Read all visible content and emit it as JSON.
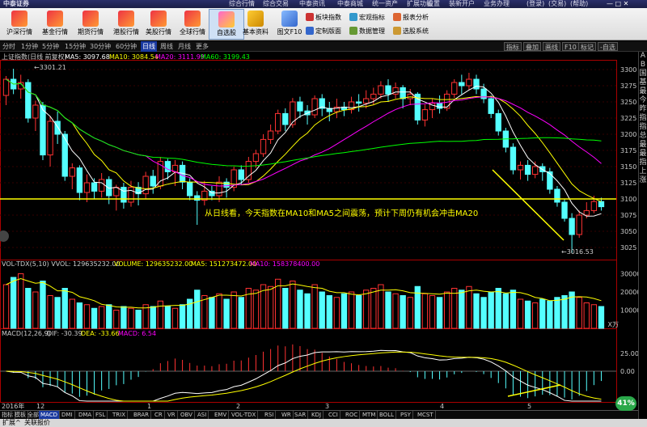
{
  "app": {
    "logo": "中泰证券",
    "menu": [
      "综合行情",
      "综合交易",
      "中泰资讯",
      "中泰商城",
      "统一资产",
      "扩展功能",
      "设置",
      "装新开户",
      "业务办理"
    ],
    "right_menu": [
      "(登录)",
      "(交易)",
      "(帮助)"
    ]
  },
  "toolbar": {
    "buttons": [
      {
        "label": "沪深行情",
        "icon": "chart-icon"
      },
      {
        "label": "基金行情",
        "icon": "chart-icon"
      },
      {
        "label": "期货行情",
        "icon": "chart-icon"
      },
      {
        "label": "港股行情",
        "icon": "chart-icon"
      },
      {
        "label": "美股行情",
        "icon": "chart-icon"
      },
      {
        "label": "全球行情",
        "icon": "chart-icon"
      },
      {
        "label": "自选股",
        "icon": "star-icon"
      },
      {
        "label": "基本资料",
        "icon": "key-icon"
      },
      {
        "label": "图文F10",
        "icon": "document-icon"
      }
    ],
    "small": [
      "板块指数",
      "宏观指标",
      "报表分析",
      "定制版面",
      "数据管理",
      "选股系统"
    ]
  },
  "period": {
    "tabs": [
      "分时",
      "1分钟",
      "5分钟",
      "15分钟",
      "30分钟",
      "60分钟",
      "日线",
      "周线",
      "月线",
      "更多"
    ],
    "active": "日线",
    "right_tools": [
      "指标",
      "叠加",
      "画线",
      "F10",
      "标记",
      "-自选"
    ]
  },
  "chart_data": [
    {
      "type": "candlestick",
      "title": "上证指数(日线 前复权)",
      "legend": [
        {
          "name": "MA5",
          "value": "3097.68",
          "color": "#ffffff"
        },
        {
          "name": "MA10",
          "value": "3084.54",
          "color": "#ffff00"
        },
        {
          "name": "MA20",
          "value": "3111.99",
          "color": "#ff00ff"
        },
        {
          "name": "MA60",
          "value": "3199.43",
          "color": "#00ff00"
        }
      ],
      "y_ticks": [
        3300,
        3275,
        3250,
        3225,
        3200,
        3175,
        3150,
        3125,
        3100,
        3075,
        3050,
        3025
      ],
      "ylim": [
        3010,
        3310
      ],
      "high_label": "3301.21",
      "low_label": "3016.53",
      "support_line": 3100,
      "annotation": "从日线看，今天指数在MA10和MA5之间震荡，预计下周仍有机会冲击MA20",
      "candles": [
        [
          3260,
          3285,
          3245,
          3290
        ],
        [
          3285,
          3270,
          3262,
          3301.21
        ],
        [
          3270,
          3280,
          3255,
          3292
        ],
        [
          3280,
          3225,
          3218,
          3285
        ],
        [
          3225,
          3245,
          3205,
          3252
        ],
        [
          3245,
          3168,
          3160,
          3250
        ],
        [
          3168,
          3220,
          3150,
          3228
        ],
        [
          3220,
          3200,
          3185,
          3235
        ],
        [
          3200,
          3135,
          3128,
          3205
        ],
        [
          3135,
          3148,
          3115,
          3155
        ],
        [
          3148,
          3110,
          3098,
          3152
        ],
        [
          3110,
          3125,
          3095,
          3138
        ],
        [
          3125,
          3112,
          3100,
          3132
        ],
        [
          3112,
          3130,
          3102,
          3140
        ],
        [
          3130,
          3105,
          3092,
          3135
        ],
        [
          3105,
          3118,
          3082,
          3122
        ],
        [
          3118,
          3095,
          3085,
          3125
        ],
        [
          3095,
          3118,
          3088,
          3128
        ],
        [
          3118,
          3108,
          3090,
          3126
        ],
        [
          3108,
          3135,
          3100,
          3142
        ],
        [
          3135,
          3120,
          3108,
          3145
        ],
        [
          3120,
          3158,
          3115,
          3165
        ],
        [
          3158,
          3142,
          3130,
          3162
        ],
        [
          3142,
          3152,
          3120,
          3160
        ],
        [
          3152,
          3126,
          3115,
          3158
        ],
        [
          3126,
          3105,
          3098,
          3132
        ],
        [
          3105,
          3098,
          3060,
          3112
        ],
        [
          3098,
          3112,
          3090,
          3128
        ],
        [
          3112,
          3105,
          3098,
          3120
        ],
        [
          3105,
          3126,
          3095,
          3135
        ],
        [
          3126,
          3118,
          3102,
          3132
        ],
        [
          3118,
          3145,
          3112,
          3150
        ],
        [
          3145,
          3130,
          3122,
          3152
        ],
        [
          3130,
          3158,
          3125,
          3165
        ],
        [
          3158,
          3170,
          3148,
          3176
        ],
        [
          3170,
          3192,
          3165,
          3200
        ],
        [
          3192,
          3205,
          3185,
          3215
        ],
        [
          3205,
          3232,
          3200,
          3238
        ],
        [
          3232,
          3215,
          3205,
          3240
        ],
        [
          3215,
          3250,
          3210,
          3256
        ],
        [
          3250,
          3236,
          3225,
          3258
        ],
        [
          3236,
          3230,
          3215,
          3245
        ],
        [
          3230,
          3255,
          3225,
          3260
        ],
        [
          3255,
          3240,
          3228,
          3262
        ],
        [
          3240,
          3235,
          3220,
          3250
        ],
        [
          3235,
          3242,
          3225,
          3255
        ],
        [
          3242,
          3238,
          3228,
          3250
        ],
        [
          3238,
          3250,
          3232,
          3258
        ],
        [
          3250,
          3248,
          3235,
          3262
        ],
        [
          3248,
          3255,
          3240,
          3268
        ],
        [
          3255,
          3262,
          3245,
          3272
        ],
        [
          3262,
          3275,
          3255,
          3282
        ],
        [
          3275,
          3262,
          3250,
          3285
        ],
        [
          3262,
          3272,
          3255,
          3280
        ],
        [
          3272,
          3255,
          3240,
          3276
        ],
        [
          3255,
          3262,
          3245,
          3270
        ],
        [
          3262,
          3222,
          3215,
          3265
        ],
        [
          3222,
          3238,
          3212,
          3246
        ],
        [
          3238,
          3248,
          3225,
          3255
        ],
        [
          3248,
          3240,
          3232,
          3260
        ],
        [
          3240,
          3262,
          3236,
          3268
        ],
        [
          3262,
          3280,
          3256,
          3285
        ],
        [
          3280,
          3275,
          3262,
          3292
        ],
        [
          3275,
          3285,
          3268,
          3295
        ],
        [
          3285,
          3270,
          3262,
          3292
        ],
        [
          3270,
          3255,
          3248,
          3278
        ],
        [
          3255,
          3232,
          3225,
          3260
        ],
        [
          3232,
          3205,
          3198,
          3238
        ],
        [
          3205,
          3180,
          3172,
          3210
        ],
        [
          3180,
          3145,
          3138,
          3186
        ],
        [
          3145,
          3152,
          3130,
          3158
        ],
        [
          3152,
          3138,
          3128,
          3160
        ],
        [
          3138,
          3150,
          3132,
          3158
        ],
        [
          3150,
          3142,
          3128,
          3155
        ],
        [
          3142,
          3115,
          3108,
          3148
        ],
        [
          3115,
          3095,
          3088,
          3120
        ],
        [
          3095,
          3070,
          3065,
          3100
        ],
        [
          3070,
          3045,
          3016.53,
          3078
        ],
        [
          3045,
          3075,
          3040,
          3082
        ],
        [
          3075,
          3082,
          3070,
          3095
        ],
        [
          3082,
          3096,
          3078,
          3105
        ],
        [
          3096,
          3088,
          3082,
          3102
        ]
      ],
      "volume": {
        "label": "VOL-TDX(5,10)",
        "vvol": "VVOL: 129635232.00",
        "volume": "VOLUME: 129635232.00",
        "ma5": "MA5: 151273472.00",
        "ma10": "MA10: 158378400.00",
        "y_ticks": [
          30000,
          20000,
          10000
        ],
        "unit": "X万",
        "values": [
          24000,
          28000,
          30000,
          22000,
          20000,
          26000,
          18000,
          17000,
          22000,
          16000,
          14000,
          13000,
          11000,
          12000,
          13000,
          10000,
          12000,
          11000,
          10000,
          13000,
          12000,
          15000,
          12000,
          11000,
          13000,
          16000,
          21000,
          18000,
          17000,
          19000,
          16000,
          20000,
          17000,
          22000,
          21000,
          24000,
          23000,
          27000,
          22000,
          26000,
          21000,
          19000,
          24000,
          20000,
          18000,
          17000,
          19000,
          20000,
          18000,
          21000,
          22000,
          24000,
          20000,
          19000,
          18000,
          17000,
          23000,
          19000,
          18000,
          17000,
          20000,
          22000,
          21000,
          23000,
          19000,
          17000,
          20000,
          22000,
          19000,
          21000,
          16000,
          15000,
          14000,
          16000,
          15000,
          17000,
          18000,
          20000,
          17000,
          14000,
          13000,
          12000
        ]
      },
      "macd": {
        "label": "MACD(12,26,9)",
        "dif": "DIF: -30.39",
        "dea": "DEA: -33.66",
        "macd": "MACD: 6.54",
        "y_ticks": [
          "25.00",
          "0.00"
        ]
      },
      "x_labels": [
        "2016年",
        "12",
        "1",
        "2",
        "3",
        "4",
        "5"
      ]
    }
  ],
  "bottom_tabs": [
    "指标",
    "模板",
    "全部",
    "MACD",
    "DMI",
    "DMA",
    "FSL",
    "TRIX",
    "BRAR",
    "CR",
    "VR",
    "OBV",
    "ASI",
    "EMV",
    "VOL-TDX",
    "RSI",
    "WR",
    "SAR",
    "KDJ",
    "CCI",
    "ROC",
    "MTM",
    "BOLL",
    "PSY",
    "MCST"
  ],
  "bottom_active": "MACD",
  "sidebar_chars": [
    "A",
    "B",
    "国",
    "基",
    "最",
    "今",
    "昨",
    "指",
    "指",
    "总",
    "最",
    "最",
    "指",
    "上",
    "涨"
  ],
  "status": [
    "扩展^",
    "关联报价"
  ],
  "badge": "41%"
}
